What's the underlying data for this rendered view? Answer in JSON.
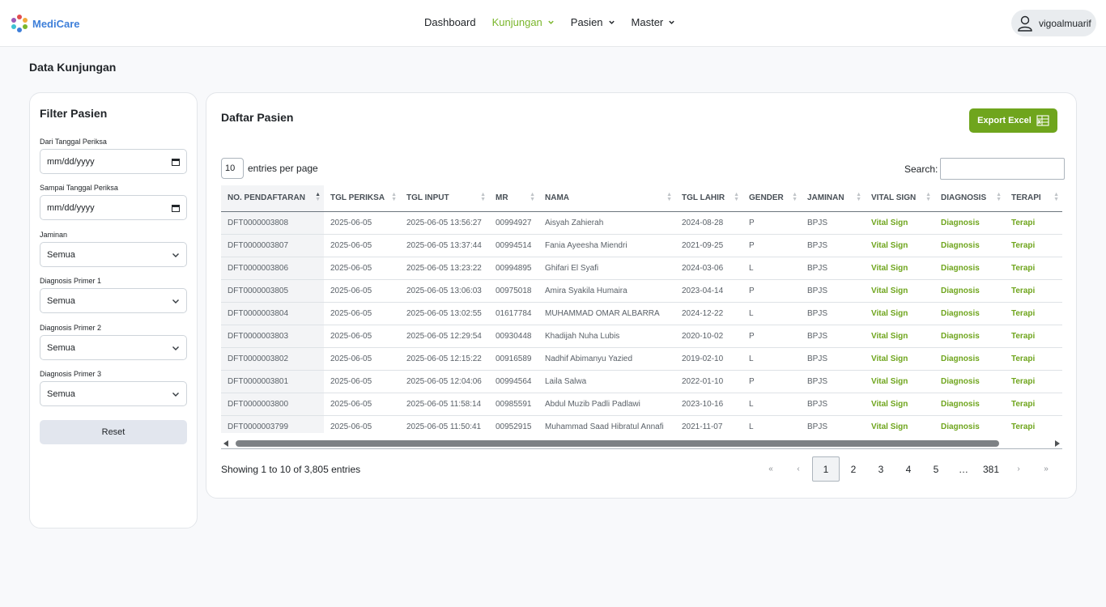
{
  "brand": {
    "name": "MediCare"
  },
  "nav": {
    "items": [
      {
        "label": "Dashboard",
        "dropdown": false,
        "active": false
      },
      {
        "label": "Kunjungan",
        "dropdown": true,
        "active": true
      },
      {
        "label": "Pasien",
        "dropdown": true,
        "active": false
      },
      {
        "label": "Master",
        "dropdown": true,
        "active": false
      }
    ],
    "active_color": "#7ab62b"
  },
  "user": {
    "name": "vigoalmuarif"
  },
  "page": {
    "title": "Data Kunjungan"
  },
  "filter": {
    "title": "Filter Pasien",
    "fields": [
      {
        "label": "Dari Tanggal Periksa",
        "value": "mm/dd/yyyy",
        "type": "date"
      },
      {
        "label": "Sampai Tanggal Periksa",
        "value": "mm/dd/yyyy",
        "type": "date"
      },
      {
        "label": "Jaminan",
        "value": "Semua",
        "type": "select"
      },
      {
        "label": "Diagnosis Primer 1",
        "value": "Semua",
        "type": "select"
      },
      {
        "label": "Diagnosis Primer 2",
        "value": "Semua",
        "type": "select"
      },
      {
        "label": "Diagnosis Primer 3",
        "value": "Semua",
        "type": "select"
      }
    ],
    "reset_label": "Reset"
  },
  "list": {
    "title": "Daftar Pasien",
    "export_label": "Export Excel",
    "accent_color": "#6fa51d",
    "entries_value": "10",
    "entries_label": "entries per page",
    "search_label": "Search:",
    "columns": [
      "NO. PENDAFTARAN",
      "TGL PERIKSA",
      "TGL INPUT",
      "MR",
      "NAMA",
      "TGL LAHIR",
      "GENDER",
      "JAMINAN",
      "VITAL SIGN",
      "DIAGNOSIS",
      "TERAPI"
    ],
    "rows": [
      [
        "DFT0000003808",
        "2025-06-05",
        "2025-06-05 13:56:27",
        "00994927",
        "Aisyah Zahierah",
        "2024-08-28",
        "P",
        "BPJS",
        "Vital Sign",
        "Diagnosis",
        "Terapi"
      ],
      [
        "DFT0000003807",
        "2025-06-05",
        "2025-06-05 13:37:44",
        "00994514",
        "Fania Ayeesha Miendri",
        "2021-09-25",
        "P",
        "BPJS",
        "Vital Sign",
        "Diagnosis",
        "Terapi"
      ],
      [
        "DFT0000003806",
        "2025-06-05",
        "2025-06-05 13:23:22",
        "00994895",
        "Ghifari El Syafi",
        "2024-03-06",
        "L",
        "BPJS",
        "Vital Sign",
        "Diagnosis",
        "Terapi"
      ],
      [
        "DFT0000003805",
        "2025-06-05",
        "2025-06-05 13:06:03",
        "00975018",
        "Amira Syakila Humaira",
        "2023-04-14",
        "P",
        "BPJS",
        "Vital Sign",
        "Diagnosis",
        "Terapi"
      ],
      [
        "DFT0000003804",
        "2025-06-05",
        "2025-06-05 13:02:55",
        "01617784",
        "MUHAMMAD OMAR ALBARRA",
        "2024-12-22",
        "L",
        "BPJS",
        "Vital Sign",
        "Diagnosis",
        "Terapi"
      ],
      [
        "DFT0000003803",
        "2025-06-05",
        "2025-06-05 12:29:54",
        "00930448",
        "Khadijah Nuha Lubis",
        "2020-10-02",
        "P",
        "BPJS",
        "Vital Sign",
        "Diagnosis",
        "Terapi"
      ],
      [
        "DFT0000003802",
        "2025-06-05",
        "2025-06-05 12:15:22",
        "00916589",
        "Nadhif Abimanyu Yazied",
        "2019-02-10",
        "L",
        "BPJS",
        "Vital Sign",
        "Diagnosis",
        "Terapi"
      ],
      [
        "DFT0000003801",
        "2025-06-05",
        "2025-06-05 12:04:06",
        "00994564",
        "Laila Salwa",
        "2022-01-10",
        "P",
        "BPJS",
        "Vital Sign",
        "Diagnosis",
        "Terapi"
      ],
      [
        "DFT0000003800",
        "2025-06-05",
        "2025-06-05 11:58:14",
        "00985591",
        "Abdul Muzib Padli Padlawi",
        "2023-10-16",
        "L",
        "BPJS",
        "Vital Sign",
        "Diagnosis",
        "Terapi"
      ],
      [
        "DFT0000003799",
        "2025-06-05",
        "2025-06-05 11:50:41",
        "00952915",
        "Muhammad Saad Hibratul Annafi",
        "2021-11-07",
        "L",
        "BPJS",
        "Vital Sign",
        "Diagnosis",
        "Terapi"
      ]
    ],
    "showing": "Showing 1 to 10 of 3,805 entries",
    "pagination": [
      "«",
      "‹",
      "1",
      "2",
      "3",
      "4",
      "5",
      "…",
      "381",
      "›",
      "»"
    ],
    "current_page": "1"
  }
}
